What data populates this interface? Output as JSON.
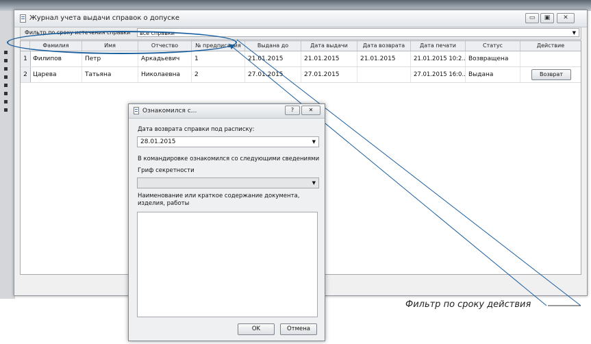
{
  "window": {
    "title": "Журнал учета выдачи справок о допуске",
    "controls": [
      "▭",
      "▣",
      "✕"
    ]
  },
  "filter": {
    "label": "Фильтр по сроку истечения справки",
    "selected": "все справки"
  },
  "table": {
    "columns": [
      "Фамилия",
      "Имя",
      "Отчество",
      "№ предписания",
      "Выдана до",
      "Дата выдачи",
      "Дата возврата",
      "Дата печати",
      "Статус",
      "Действие"
    ],
    "rows": [
      {
        "num": "1",
        "cells": [
          "Филипов",
          "Петр",
          "Аркадьевич",
          "1",
          "21.01.2015",
          "21.01.2015",
          "21.01.2015",
          "21.01.2015 10:2...",
          "Возвращена",
          ""
        ]
      },
      {
        "num": "2",
        "cells": [
          "Царева",
          "Татьяна",
          "Николаевна",
          "2",
          "27.01.2015",
          "27.01.2015",
          "",
          "27.01.2015 16:0...",
          "Выдана",
          ""
        ],
        "action": "Возврат"
      }
    ]
  },
  "dialog": {
    "title": "Ознакомился с...",
    "help": "?",
    "close": "✕",
    "date_label": "Дата возврата справки под расписку:",
    "date_value": "28.01.2015",
    "info_text": "В командировке ознакомился со следующими сведениями",
    "secrecy_label": "Гриф секретности",
    "secrecy_value": "",
    "doc_label": "Наименование или краткое содержание документа, изделия, работы",
    "ok": "OK",
    "cancel": "Отмена"
  },
  "annotation": {
    "text": "Фильтр по сроку действия"
  },
  "colors": {
    "annotation_line": "#1b5e9d"
  }
}
